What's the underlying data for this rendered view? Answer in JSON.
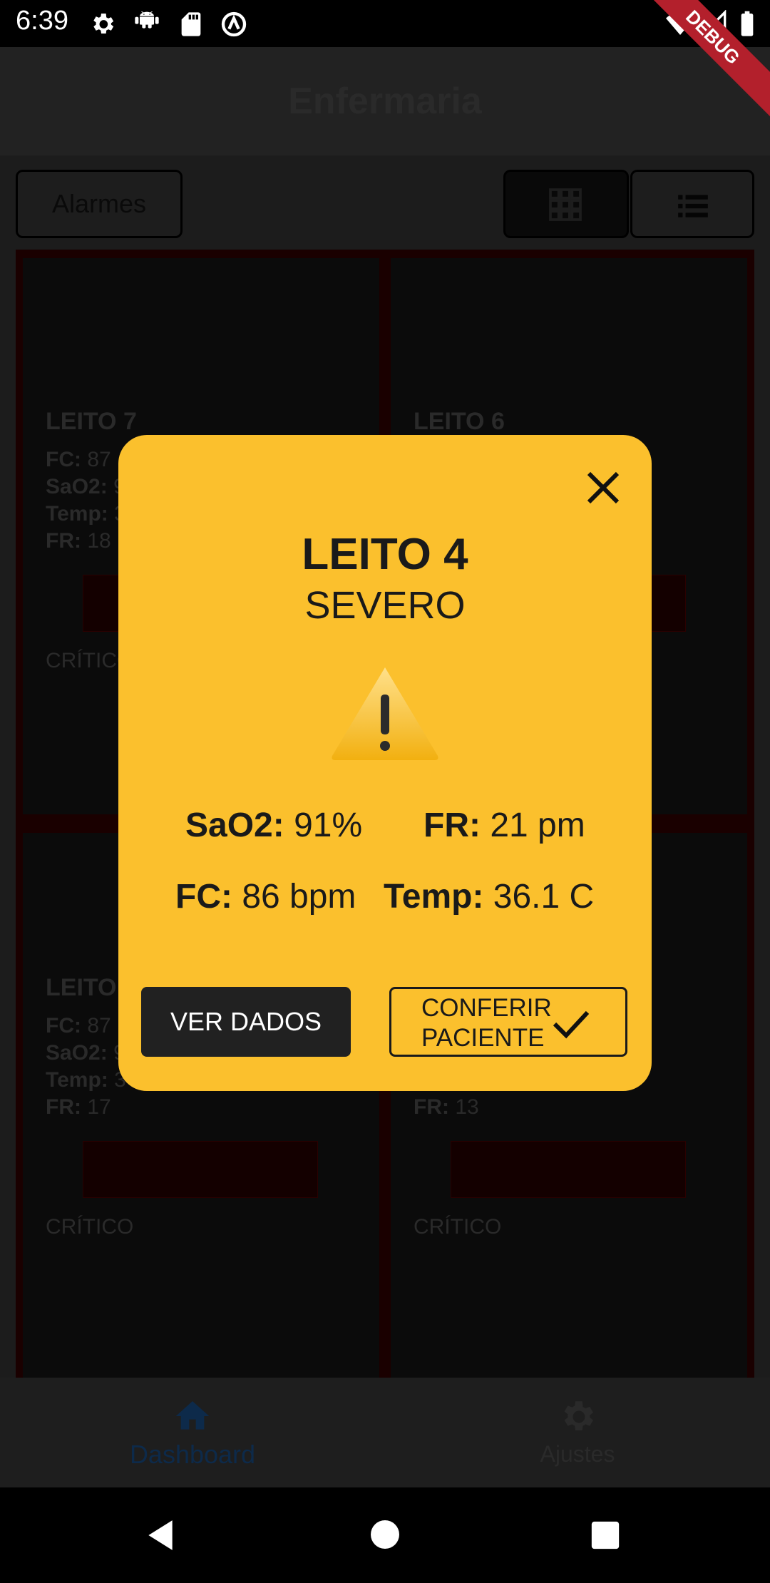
{
  "status_bar": {
    "time": "6:39",
    "debug_label": "DEBUG"
  },
  "app_bar": {
    "title": "Enfermaria"
  },
  "controls": {
    "alarms_label": "Alarmes"
  },
  "beds": [
    {
      "label": "LEITO 7",
      "fc_label": "FC:",
      "fc": "87",
      "sao2_label": "SaO2:",
      "sao2": "9",
      "temp_label": "Temp:",
      "temp": "3",
      "fr_label": "FR:",
      "fr": "18",
      "status": "CRÍTICO"
    },
    {
      "label": "LEITO 6",
      "status": ""
    },
    {
      "label": "LEITO",
      "fc_label": "FC:",
      "fc": "87",
      "sao2_label": "SaO2:",
      "sao2": "9",
      "temp_label": "Temp:",
      "temp": "3",
      "fr_label": "FR:",
      "fr": "17",
      "status": "CRÍTICO"
    },
    {
      "label": "",
      "fr_label": "FR:",
      "fr": "13",
      "status": "CRÍTICO"
    }
  ],
  "bottom_nav": {
    "items": [
      {
        "label": "Dashboard",
        "icon": "home-icon",
        "active": true
      },
      {
        "label": "Ajustes",
        "icon": "gear-icon",
        "active": false
      }
    ]
  },
  "dialog": {
    "title": "LEITO 4",
    "severity": "SEVERO",
    "vitals": {
      "sao2_label": "SaO2:",
      "sao2_value": "91%",
      "fr_label": "FR:",
      "fr_value": "21 pm",
      "fc_label": "FC:",
      "fc_value": "86 bpm",
      "temp_label": "Temp:",
      "temp_value": "36.1 C"
    },
    "ver_dados_label": "VER DADOS",
    "conferir_line1": "CONFERIR",
    "conferir_line2": "PACIENTE"
  },
  "colors": {
    "dialog_bg": "#fbc02d",
    "dark_button": "#212121",
    "nav_active": "#0d2a4a"
  }
}
